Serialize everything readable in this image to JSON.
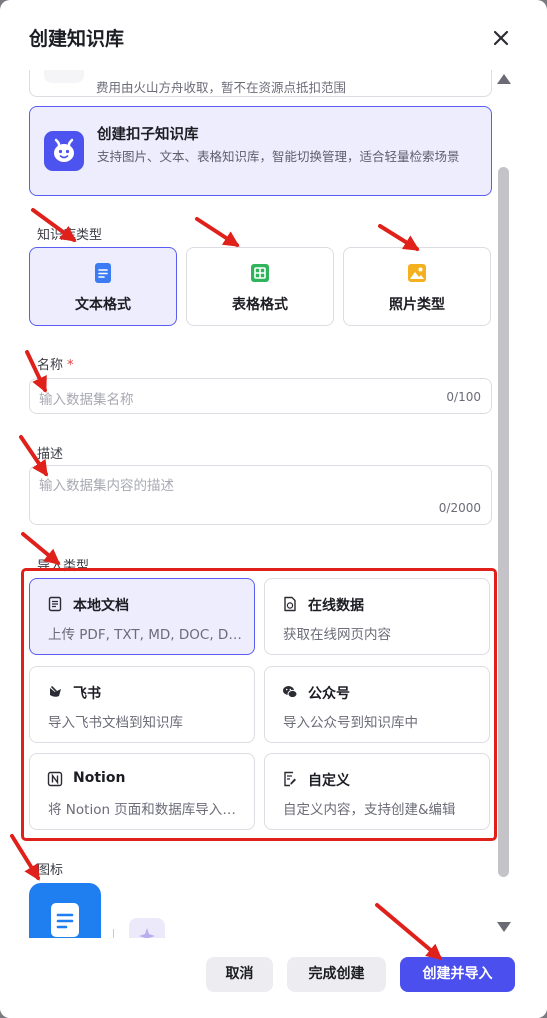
{
  "dialog": {
    "title": "创建知识库"
  },
  "previous_option": {
    "desc": "费用由火山方舟收取，暂不在资源点抵扣范围"
  },
  "kozi_option": {
    "title": "创建扣子知识库",
    "desc": "支持图片、文本、表格知识库，智能切换管理，适合轻量检索场景"
  },
  "kb_type": {
    "label": "知识库类型",
    "options": [
      {
        "label": "文本格式",
        "selected": true,
        "icon": "text-doc-icon",
        "color": "#3b7cf4"
      },
      {
        "label": "表格格式",
        "selected": false,
        "icon": "table-icon",
        "color": "#2fb35b"
      },
      {
        "label": "照片类型",
        "selected": false,
        "icon": "image-icon",
        "color": "#f5b01f"
      }
    ]
  },
  "name_field": {
    "label": "名称",
    "required_mark": "*",
    "placeholder": "输入数据集名称",
    "counter": "0/100"
  },
  "desc_field": {
    "label": "描述",
    "placeholder": "输入数据集内容的描述",
    "counter": "0/2000"
  },
  "import_type": {
    "label": "导入类型",
    "options": [
      {
        "title": "本地文档",
        "desc": "上传 PDF, TXT, MD, DOC, DOCX 格式的本地文件",
        "icon": "file-icon",
        "selected": true
      },
      {
        "title": "在线数据",
        "desc": "获取在线网页内容",
        "icon": "web-page-icon",
        "selected": false
      },
      {
        "title": "飞书",
        "desc": "导入飞书文档到知识库",
        "icon": "feishu-icon",
        "selected": false
      },
      {
        "title": "公众号",
        "desc": "导入公众号到知识库中",
        "icon": "wechat-icon",
        "selected": false
      },
      {
        "title": "Notion",
        "desc": "将 Notion 页面和数据库导入到知识库中",
        "icon": "notion-icon",
        "selected": false
      },
      {
        "title": "自定义",
        "desc": "自定义内容，支持创建&编辑",
        "icon": "custom-edit-icon",
        "selected": false
      }
    ]
  },
  "icon_section": {
    "label": "图标"
  },
  "footer": {
    "cancel": "取消",
    "done": "完成创建",
    "create_import": "创建并导入"
  },
  "colors": {
    "accent": "#4b4fee",
    "highlight_box": "#e0201b",
    "arrow": "#e0201b"
  }
}
